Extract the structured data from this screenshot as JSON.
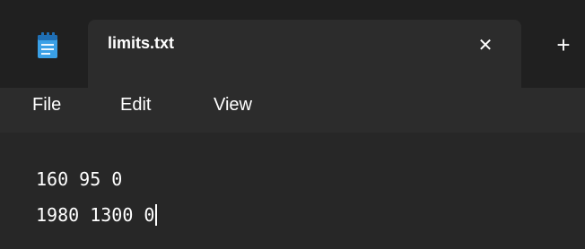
{
  "tab": {
    "title": "limits.txt",
    "close_glyph": "✕",
    "app_icon": "notepad-icon",
    "new_tab_glyph": "+"
  },
  "menu": {
    "file": "File",
    "edit": "Edit",
    "view": "View"
  },
  "editor": {
    "lines": [
      "160 95 0",
      "1980 1300 0"
    ]
  },
  "colors": {
    "tabstrip": "#202020",
    "active_tab": "#2c2c2c",
    "editor_bg": "#272727",
    "icon_accent": "#3aa0e6",
    "text": "#ffffff"
  }
}
